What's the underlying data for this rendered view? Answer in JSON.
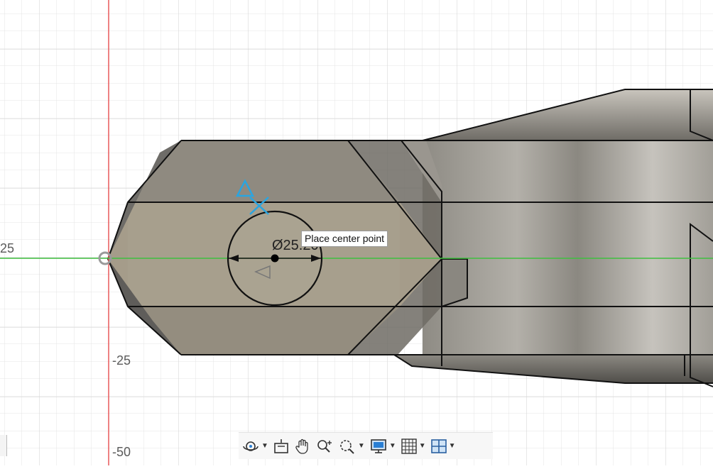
{
  "axis_labels": {
    "y_25": "25",
    "y_neg25": "-25",
    "y_neg50": "-50"
  },
  "sketch": {
    "diameter_text": "Ø25.20",
    "tooltip": "Place center point"
  },
  "toolbar": {
    "items": [
      {
        "name": "orbit",
        "icon": "orbit-icon",
        "has_dropdown": true
      },
      {
        "name": "look-at",
        "icon": "look-at-icon",
        "has_dropdown": false
      },
      {
        "name": "pan",
        "icon": "pan-hand-icon",
        "has_dropdown": false
      },
      {
        "name": "zoom",
        "icon": "zoom-icon",
        "has_dropdown": false
      },
      {
        "name": "zoom-window",
        "icon": "zoom-window-icon",
        "has_dropdown": true
      },
      {
        "name": "display-settings",
        "icon": "display-monitor-icon",
        "has_dropdown": true
      },
      {
        "name": "grid-snaps",
        "icon": "grid-icon",
        "has_dropdown": true
      },
      {
        "name": "viewports",
        "icon": "viewports-icon",
        "has_dropdown": true
      }
    ]
  },
  "colors": {
    "grid_line": "#e3e3e3",
    "y_axis": "#e8585a",
    "x_axis": "#3fbf3f",
    "body_light": "#a69e8c",
    "body_dark": "#6d6a63",
    "sketch_blue": "#2aa5e0"
  }
}
